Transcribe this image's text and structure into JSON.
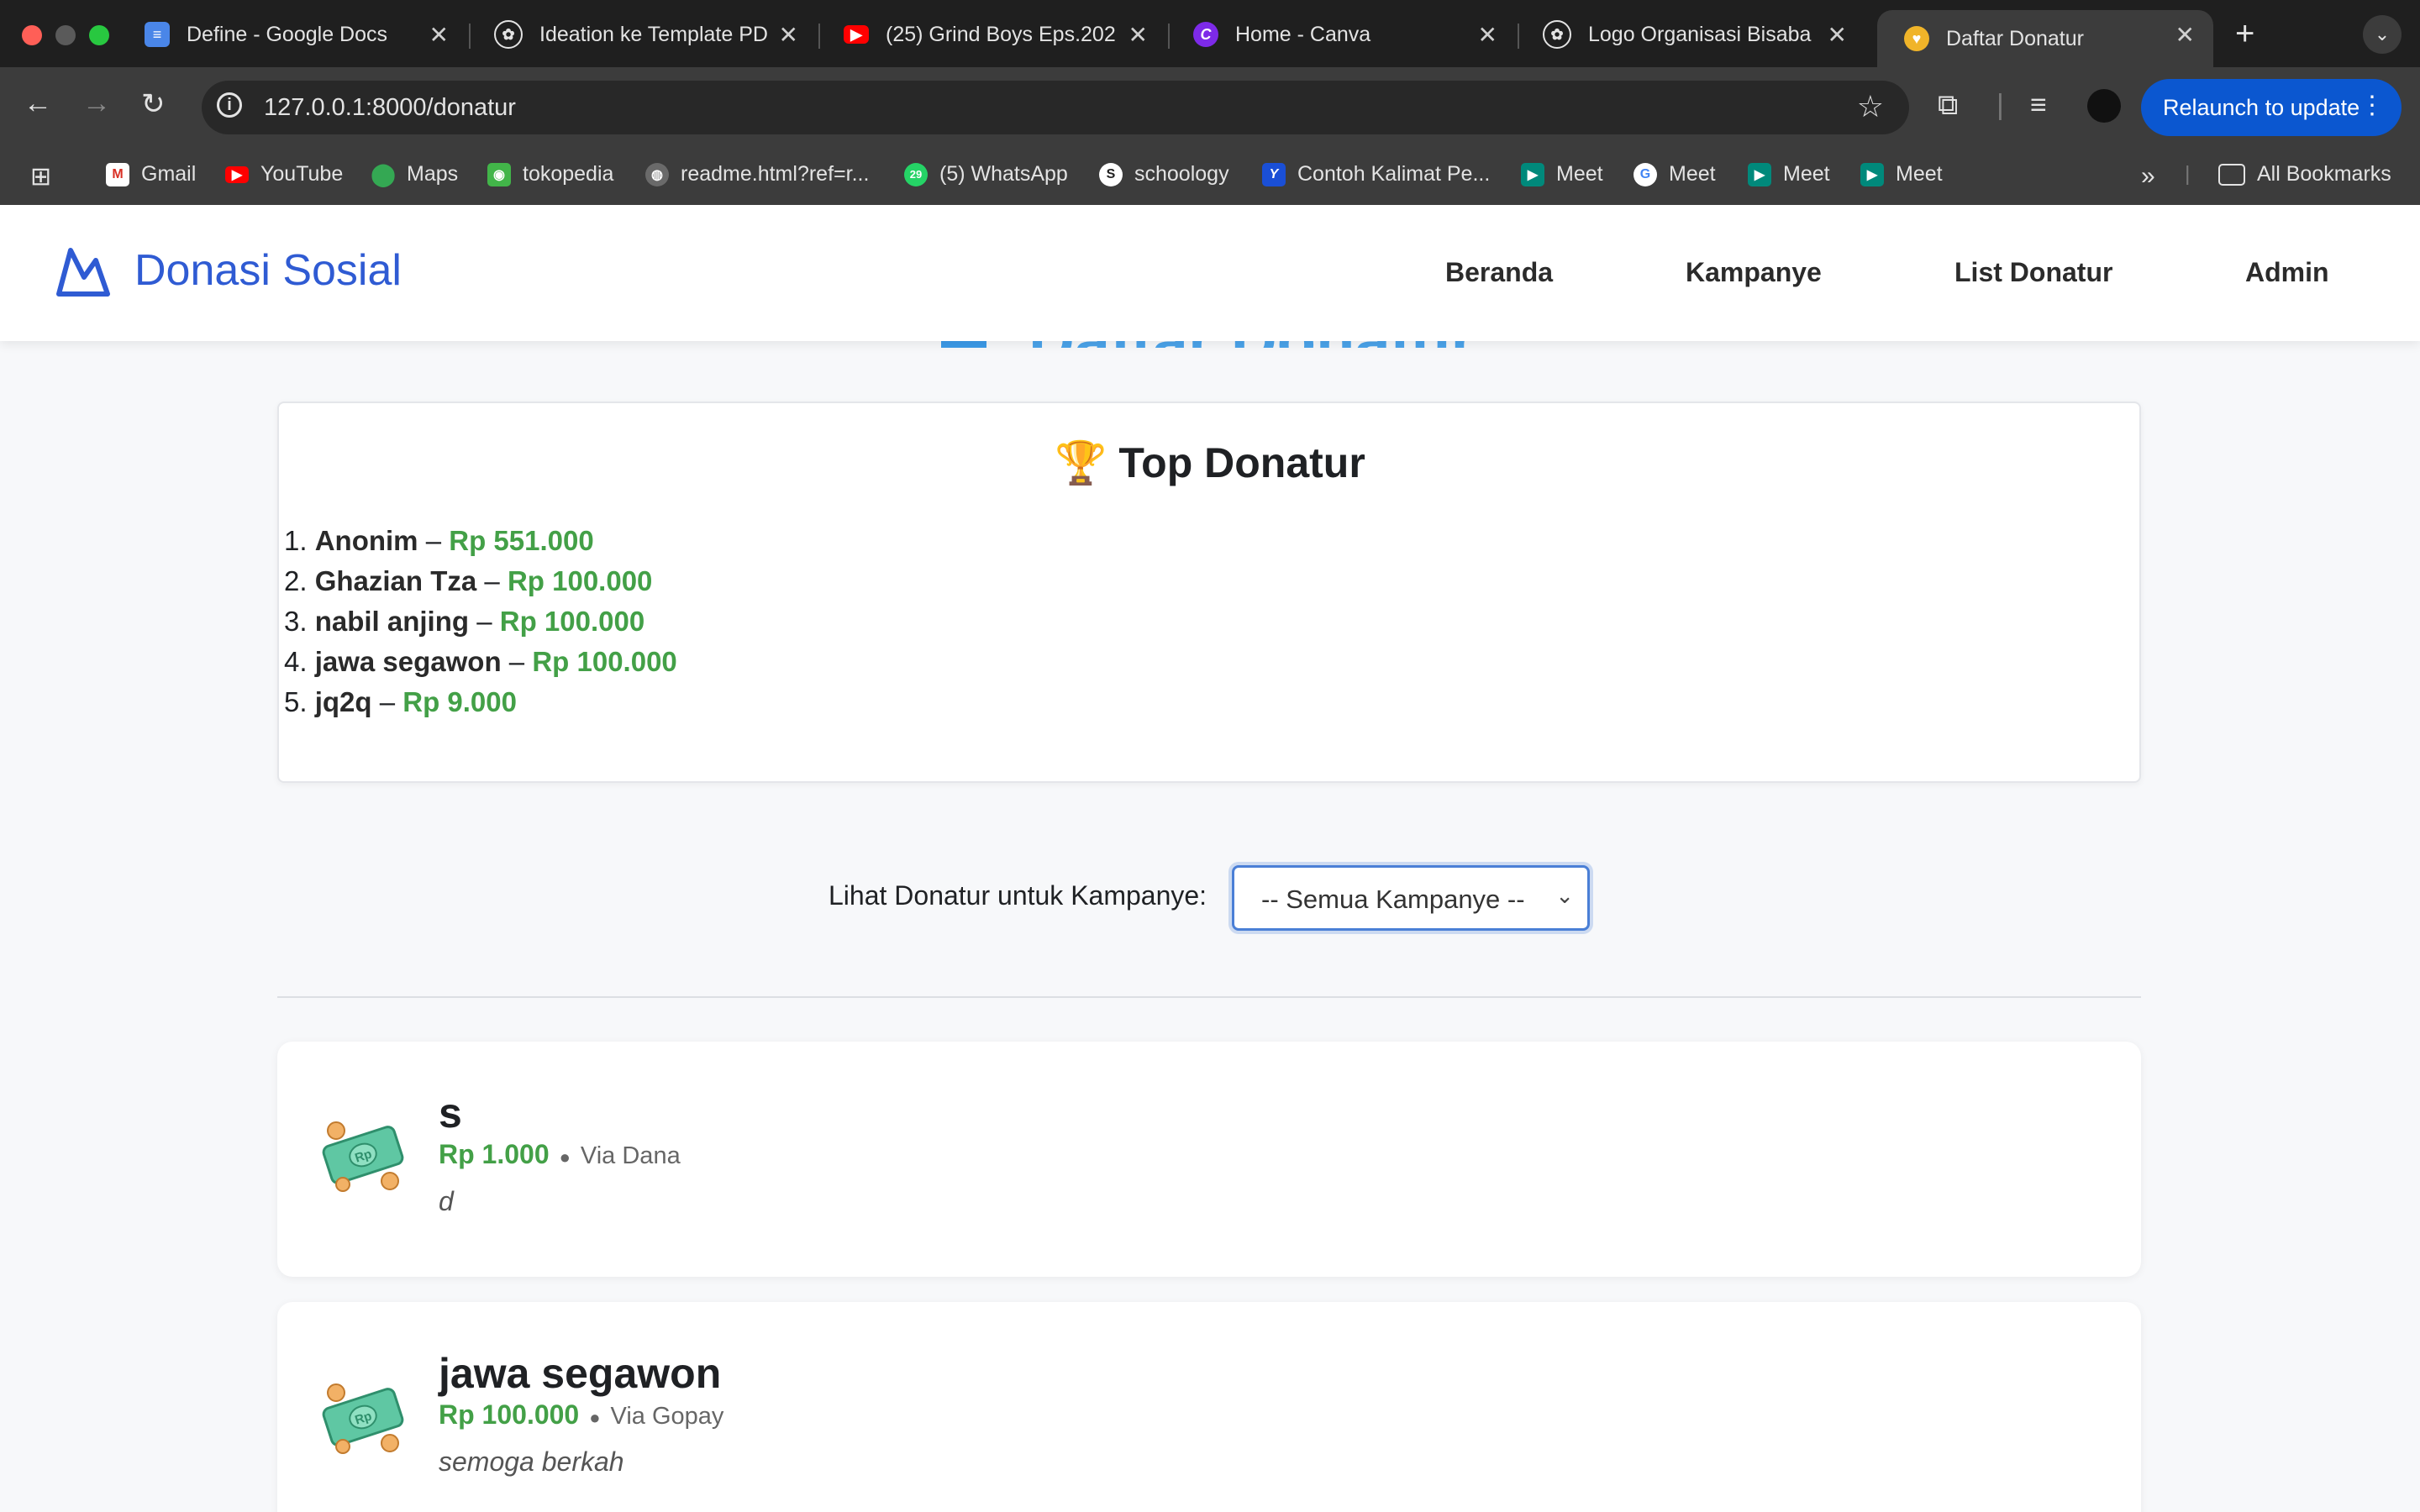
{
  "browser": {
    "tabs": [
      {
        "title": "Define - Google Docs",
        "icon": "google-docs-icon",
        "color": "#4a86e8"
      },
      {
        "title": "Ideation ke Template PD",
        "icon": "chatgpt-icon",
        "color": "#ffffff"
      },
      {
        "title": "(25) Grind Boys Eps.202",
        "icon": "youtube-icon",
        "color": "#ff0000"
      },
      {
        "title": "Home - Canva",
        "icon": "canva-icon",
        "color": "#7d2ae8"
      },
      {
        "title": "Logo Organisasi Bisaba",
        "icon": "chatgpt-icon",
        "color": "#ffffff"
      },
      {
        "title": "Daftar Donatur",
        "icon": "heart-hand-icon",
        "color": "#f0b429",
        "active": true
      }
    ],
    "url": "127.0.0.1:8000/donatur",
    "relaunch_label": "Relaunch to update",
    "bookmarks": [
      {
        "label": "Gmail",
        "icon": "gmail-icon"
      },
      {
        "label": "YouTube",
        "icon": "youtube-icon"
      },
      {
        "label": "Maps",
        "icon": "maps-icon"
      },
      {
        "label": "tokopedia",
        "icon": "tokopedia-icon"
      },
      {
        "label": "readme.html?ref=r...",
        "icon": "globe-icon"
      },
      {
        "label": "(5) WhatsApp",
        "icon": "whatsapp-icon"
      },
      {
        "label": "schoology",
        "icon": "schoology-icon"
      },
      {
        "label": "Contoh Kalimat Pe...",
        "icon": "bookmark-site-icon"
      },
      {
        "label": "Meet",
        "icon": "meet-icon"
      },
      {
        "label": "Meet",
        "icon": "google-icon"
      },
      {
        "label": "Meet",
        "icon": "meet-icon"
      },
      {
        "label": "Meet",
        "icon": "meet-icon"
      }
    ],
    "all_bookmarks_label": "All Bookmarks"
  },
  "site": {
    "brand": "Donasi Sosial",
    "nav": [
      "Beranda",
      "Kampanye",
      "List Donatur",
      "Admin"
    ],
    "page_heading": "Daftar Donatur"
  },
  "top_donatur": {
    "title": "Top Donatur",
    "items": [
      {
        "rank": "1.",
        "name": "Anonim",
        "amount": "Rp 551.000"
      },
      {
        "rank": "2.",
        "name": "Ghazian Tza",
        "amount": "Rp 100.000"
      },
      {
        "rank": "3.",
        "name": "nabil anjing",
        "amount": "Rp 100.000"
      },
      {
        "rank": "4.",
        "name": "jawa segawon",
        "amount": "Rp 100.000"
      },
      {
        "rank": "5.",
        "name": "jq2q",
        "amount": "Rp 9.000"
      }
    ]
  },
  "filter": {
    "label": "Lihat Donatur untuk Kampanye:",
    "selected": "-- Semua Kampanye --"
  },
  "donations": [
    {
      "name": "s",
      "amount": "Rp 1.000",
      "via": "Via Dana",
      "message": "d"
    },
    {
      "name": "jawa segawon",
      "amount": "Rp 100.000",
      "via": "Via Gopay",
      "message": "semoga berkah"
    }
  ],
  "colors": {
    "accent": "#2f5bd3",
    "money": "#43a047",
    "heading_faded": "#4aa3ea"
  }
}
